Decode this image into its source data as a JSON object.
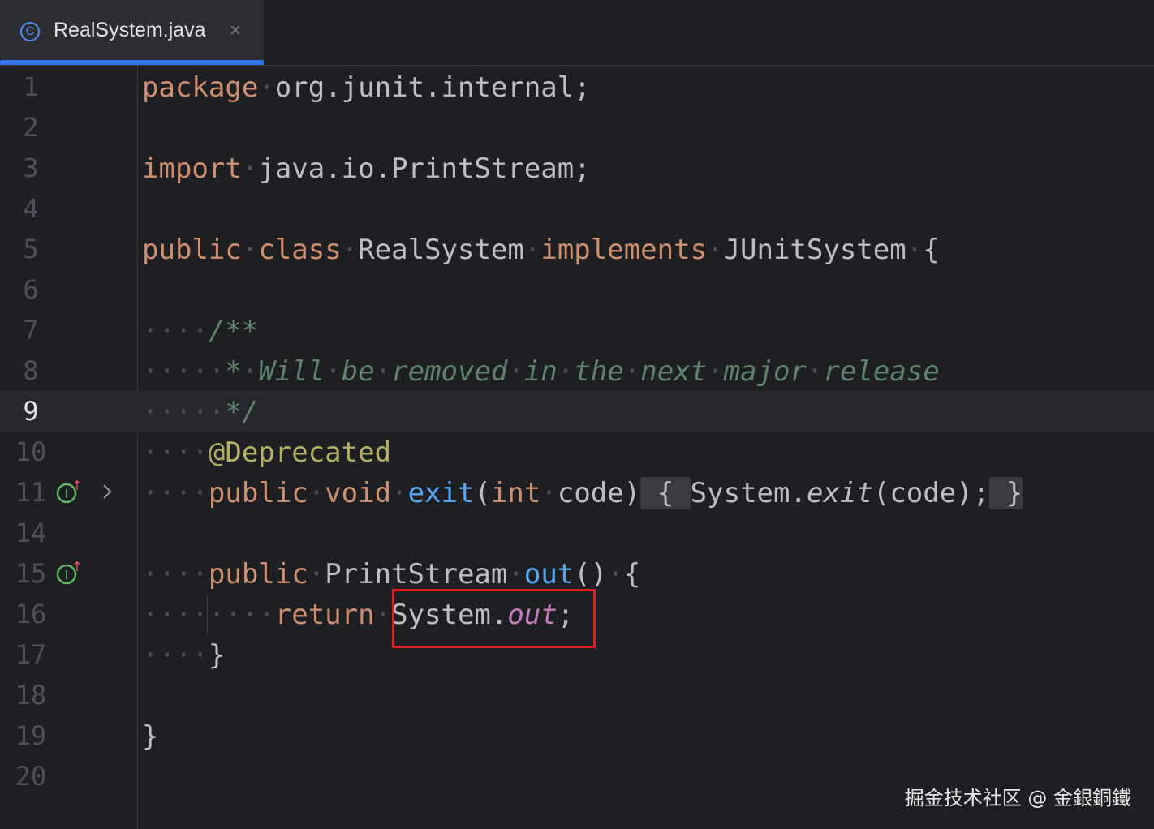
{
  "tab": {
    "icon": "class-icon",
    "icon_glyph": "C",
    "title": "RealSystem.java",
    "close": "×"
  },
  "lines": [
    {
      "num": "1"
    },
    {
      "num": "2"
    },
    {
      "num": "3"
    },
    {
      "num": "4"
    },
    {
      "num": "5"
    },
    {
      "num": "6"
    },
    {
      "num": "7"
    },
    {
      "num": "8"
    },
    {
      "num": "9"
    },
    {
      "num": "10"
    },
    {
      "num": "11"
    },
    {
      "num": "14"
    },
    {
      "num": "15"
    },
    {
      "num": "16"
    },
    {
      "num": "17"
    },
    {
      "num": "18"
    },
    {
      "num": "19"
    },
    {
      "num": "20"
    }
  ],
  "code": {
    "package_kw": "package",
    "package_name": "org.junit.internal;",
    "import_kw": "import",
    "import_name": "java.io.PrintStream;",
    "public_kw": "public",
    "class_kw": "class",
    "class_name": "RealSystem",
    "implements_kw": "implements",
    "interface_name": "JUnitSystem",
    "open_brace": "{",
    "comment_open": "/**",
    "comment_star": "*",
    "comment_text": [
      "Will",
      "be",
      "removed",
      "in",
      "the",
      "next",
      "major",
      "release"
    ],
    "comment_close": "*/",
    "annotation": "@Deprecated",
    "void_kw": "void",
    "exit_name": "exit",
    "paren_open": "(",
    "int_kw": "int",
    "param": "code)",
    "fold_open": "{",
    "system_prefix": "System.",
    "exit_call": "exit",
    "call_args": "(code);",
    "fold_close": "}",
    "printstream_type": "PrintStream",
    "out_name": "out",
    "parens_brace": "()",
    "return_kw": "return",
    "out_field": "out",
    "semicolon": ";",
    "close_brace": "}"
  },
  "gutter": {
    "implements_icon": "I",
    "arrow": "↑"
  },
  "watermark": "掘金技术社区 @ 金銀銅鐵",
  "colors": {
    "background": "#1e1f22",
    "keyword": "#cf8e6d",
    "comment": "#5f826b",
    "annotation": "#b3ae60",
    "method": "#56a8f5",
    "static_field": "#c77dbb",
    "highlight_box": "#e02020"
  }
}
